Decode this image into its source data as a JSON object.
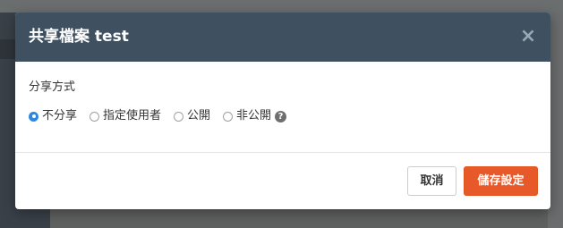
{
  "dialog": {
    "title": "共享檔案 test",
    "close_symbol": "×"
  },
  "sharing": {
    "label": "分享方式",
    "options": [
      {
        "label": "不分享",
        "checked": true
      },
      {
        "label": "指定使用者",
        "checked": false
      },
      {
        "label": "公開",
        "checked": false
      },
      {
        "label": "非公開",
        "checked": false
      }
    ],
    "help_symbol": "?"
  },
  "footer": {
    "cancel_label": "取消",
    "save_label": "儲存設定"
  },
  "colors": {
    "header_bg": "#3f5161",
    "primary_button": "#e8592a",
    "radio_selected": "#2d86e0"
  }
}
